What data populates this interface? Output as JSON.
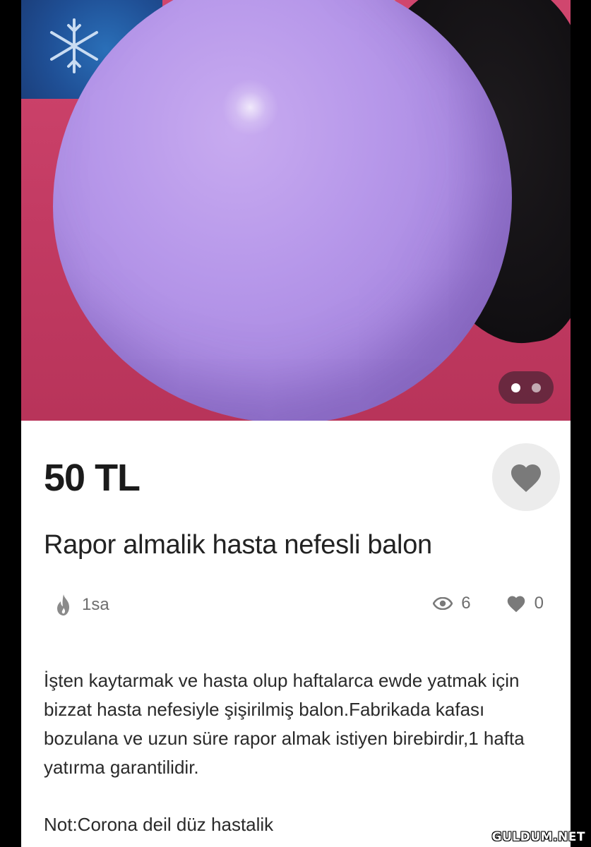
{
  "listing": {
    "image": {
      "description_icon": "balloon-photo",
      "carousel_dots": 2,
      "active_dot": 1
    },
    "price": "50 TL",
    "title": "Rapor almalik hasta nefesli balon",
    "meta": {
      "time_ago": "1sa",
      "views": "6",
      "likes": "0"
    },
    "description": "İşten kaytarmak ve hasta olup haftalarca ewde yatmak için bizzat hasta nefesiyle şişirilmiş balon.Fabrikada kafası bozulana ve uzun süre rapor almak istiyen birebirdir,1 hafta yatırma garantilidir.",
    "note": "Not:Corona deil düz hastalik"
  },
  "watermark": "GULDUM.NET",
  "colors": {
    "card_bg": "#ffffff",
    "price_text": "#1b1b1b",
    "meta_gray": "#6e6e6e",
    "fav_button_bg": "#ececec",
    "fav_icon": "#7a7a7a",
    "balloon": "#b798ea"
  }
}
